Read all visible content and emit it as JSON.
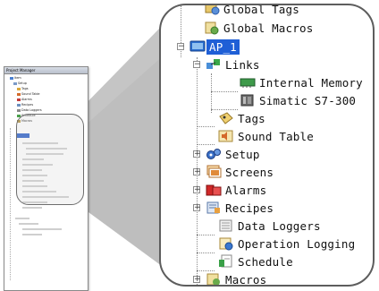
{
  "mini_window": {
    "title": "Project Manager",
    "rows": [
      "Item",
      "Setup",
      "Tags",
      "Sound Table",
      "Alarms",
      "Recipes",
      "Data Loggers",
      "Schedule",
      "Macros"
    ]
  },
  "zoom_tree": {
    "items": [
      {
        "label": "Global Tags",
        "icon": "global-tags-icon"
      },
      {
        "label": "Global Macros",
        "icon": "global-macros-icon"
      },
      {
        "label": "AP_1",
        "icon": "monitor-icon",
        "selected": true,
        "expander": "−"
      },
      {
        "label": "Links",
        "icon": "links-icon",
        "expander": "−"
      },
      {
        "label": "Internal Memory",
        "icon": "memory-icon"
      },
      {
        "label": "Simatic S7-300",
        "icon": "plc-icon"
      },
      {
        "label": "Tags",
        "icon": "tags-icon"
      },
      {
        "label": "Sound Table",
        "icon": "sound-icon"
      },
      {
        "label": "Setup",
        "icon": "gears-icon",
        "expander": "+"
      },
      {
        "label": "Screens",
        "icon": "screens-icon",
        "expander": "+"
      },
      {
        "label": "Alarms",
        "icon": "alarms-icon",
        "expander": "+"
      },
      {
        "label": "Recipes",
        "icon": "recipes-icon",
        "expander": "+"
      },
      {
        "label": "Data Loggers",
        "icon": "data-loggers-icon"
      },
      {
        "label": "Operation Logging",
        "icon": "operation-logging-icon"
      },
      {
        "label": "Schedule",
        "icon": "schedule-icon"
      },
      {
        "label": "Macros",
        "icon": "macros-icon",
        "expander": "+"
      }
    ]
  },
  "colors": {
    "selection": "#1f5fd6",
    "border": "#5d5d5d",
    "cone": "#a8a8a8"
  }
}
